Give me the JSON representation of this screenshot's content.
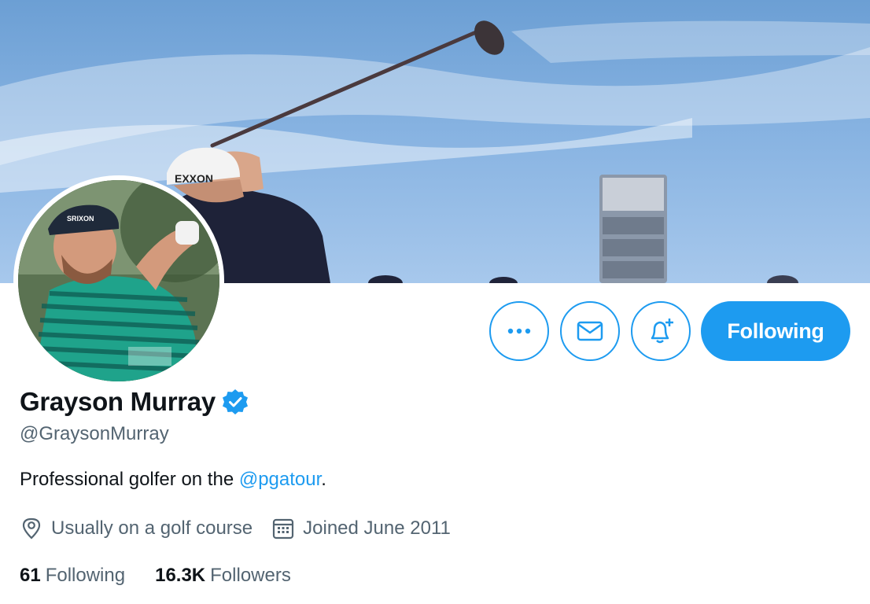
{
  "profile": {
    "name": "Grayson Murray",
    "handle": "@GraysonMurray",
    "bio_text": "Professional golfer on the ",
    "bio_mention": "@pgatour",
    "bio_end": ".",
    "location": "Usually on a golf course",
    "joined": "Joined June 2011",
    "verified": true
  },
  "stats": {
    "following_count": "61",
    "following_label": "Following",
    "followers_count": "16.3K",
    "followers_label": "Followers"
  },
  "actions": {
    "follow_label": "Following",
    "more_icon": "more-icon",
    "message_icon": "envelope-icon",
    "notify_icon": "bell-plus-icon"
  },
  "banner_tee_sign": "EXXON",
  "avatar_cap_logo": "SRIXON",
  "colors": {
    "accent": "#1d9bf0",
    "text_primary": "#0f1419",
    "text_secondary": "#536471"
  }
}
